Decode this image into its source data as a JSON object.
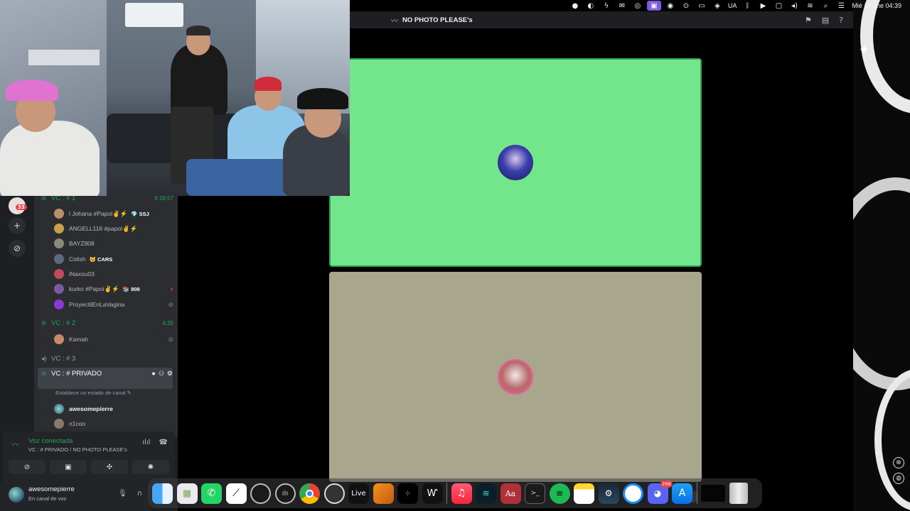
{
  "menubar": {
    "keyboard_layout": "UA",
    "datetime": "Mié 14 ene  04:39",
    "icons": [
      "record-icon",
      "theme-icon",
      "bolt-icon",
      "mail-icon",
      "vpn-icon",
      "stage-manager-icon",
      "camera-icon",
      "location-icon",
      "car-icon",
      "eye-icon",
      "keyboard-layout",
      "bluetooth-icon",
      "play-icon",
      "display-icon",
      "volume-icon",
      "wifi-icon",
      "search-icon",
      "control-center-icon"
    ]
  },
  "window": {
    "title": "NO PHOTO PLEASE's"
  },
  "rail": {
    "unread_badge": "33"
  },
  "channels": {
    "vc1": {
      "name": "VC : # 1",
      "time": "6:18:57"
    },
    "vc1_members": [
      {
        "name": "l Johana #Papol✌⚡",
        "tag": "💎 SSJ",
        "color": "#b8906a"
      },
      {
        "name": "ANGELL116 #papol✌⚡",
        "tag": "",
        "color": "#c9a04a"
      },
      {
        "name": "BAYZ808",
        "tag": "",
        "color": "#8a8a7a"
      },
      {
        "name": "Colish",
        "tag": "😼 CARS",
        "color": "#5a6b80"
      },
      {
        "name": "iNaxou03",
        "tag": "",
        "color": "#c24a5a"
      },
      {
        "name": "kurko #Papoi✌⚡",
        "tag": "📚 808",
        "color": "#7a5aa0",
        "mute": "red"
      },
      {
        "name": "ProyectilEnLaVagina",
        "tag": "",
        "color": "#8a3ad0",
        "mute": "grey"
      }
    ],
    "vc2": {
      "name": "VC : # 2",
      "time": "4:25"
    },
    "vc2_members": [
      {
        "name": "Kamah",
        "color": "#c98a6a",
        "mute": "grey"
      }
    ],
    "vc3": {
      "name": "VC : # 3"
    },
    "vc_private": {
      "name": "VC : # PRIVADO",
      "status": "Establece un estado de canal"
    },
    "private_members": [
      {
        "name": "awesomepierre",
        "color": "#3a7a8a"
      },
      {
        "name": "n1coo",
        "color": "#8a7a6a"
      }
    ]
  },
  "voice": {
    "status": "Voz conectada",
    "location": "VC : # PRIVADO / NO PHOTO PLEASE's"
  },
  "user": {
    "name": "awesomepierre",
    "status": "En canal de voz"
  },
  "dock": {
    "live_label": "Live",
    "dict_label": "Aa",
    "discord_badge": "298",
    "apps": [
      "finder",
      "launchpad",
      "whatsapp",
      "capcut",
      "logic-pro",
      "mixer",
      "chrome",
      "obs",
      "live",
      "fl-studio",
      "tidal",
      "waves",
      "music",
      "kraken",
      "dictionary",
      "terminal",
      "spotify",
      "notes",
      "steam",
      "safari",
      "discord",
      "app-store",
      "window-thumb",
      "trash"
    ]
  },
  "colors": {
    "accent_green": "#23a55a",
    "tile_green": "#73e58a",
    "tile_beige": "#a8a68c",
    "discord_bg": "#2b2d31"
  }
}
